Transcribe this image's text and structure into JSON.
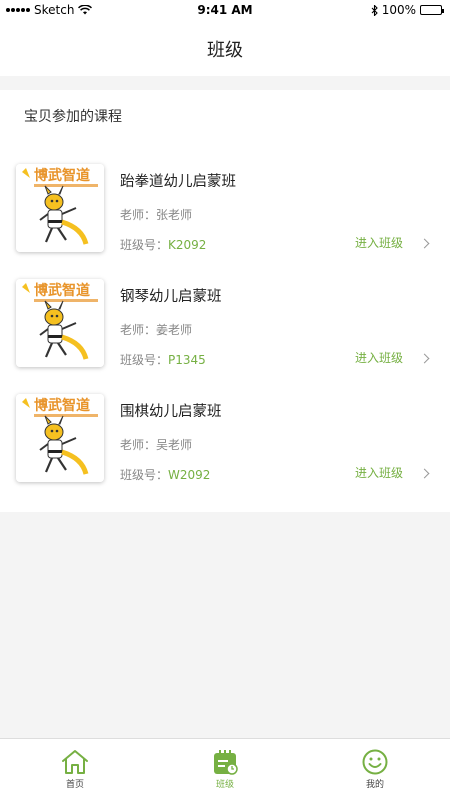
{
  "status_bar": {
    "carrier": "Sketch",
    "time": "9:41 AM",
    "battery": "100%",
    "battery_level": 1.0
  },
  "nav": {
    "title": "班级"
  },
  "section": {
    "title": "宝贝参加的课程"
  },
  "courses": [
    {
      "name": "跆拳道幼儿启蒙班",
      "teacher_label": "老师：",
      "teacher": "张老师",
      "code_label": "班级号：",
      "code": "K2092",
      "action": "进入班级"
    },
    {
      "name": "钢琴幼儿启蒙班",
      "teacher_label": "老师：",
      "teacher": "姜老师",
      "code_label": "班级号：",
      "code": "P1345",
      "action": "进入班级"
    },
    {
      "name": "围棋幼儿启蒙班",
      "teacher_label": "老师：",
      "teacher": "吴老师",
      "code_label": "班级号：",
      "code": "W2092",
      "action": "进入班级"
    }
  ],
  "thumbnail": {
    "brand_text": "博武智道"
  },
  "tabs": [
    {
      "label": "首页",
      "icon": "home-icon",
      "active": false
    },
    {
      "label": "班级",
      "icon": "class-calendar-icon",
      "active": true
    },
    {
      "label": "我的",
      "icon": "smile-icon",
      "active": false
    }
  ],
  "colors": {
    "accent": "#76b043",
    "brand_orange": "#e8942a",
    "kangaroo_yellow": "#f5c020"
  }
}
